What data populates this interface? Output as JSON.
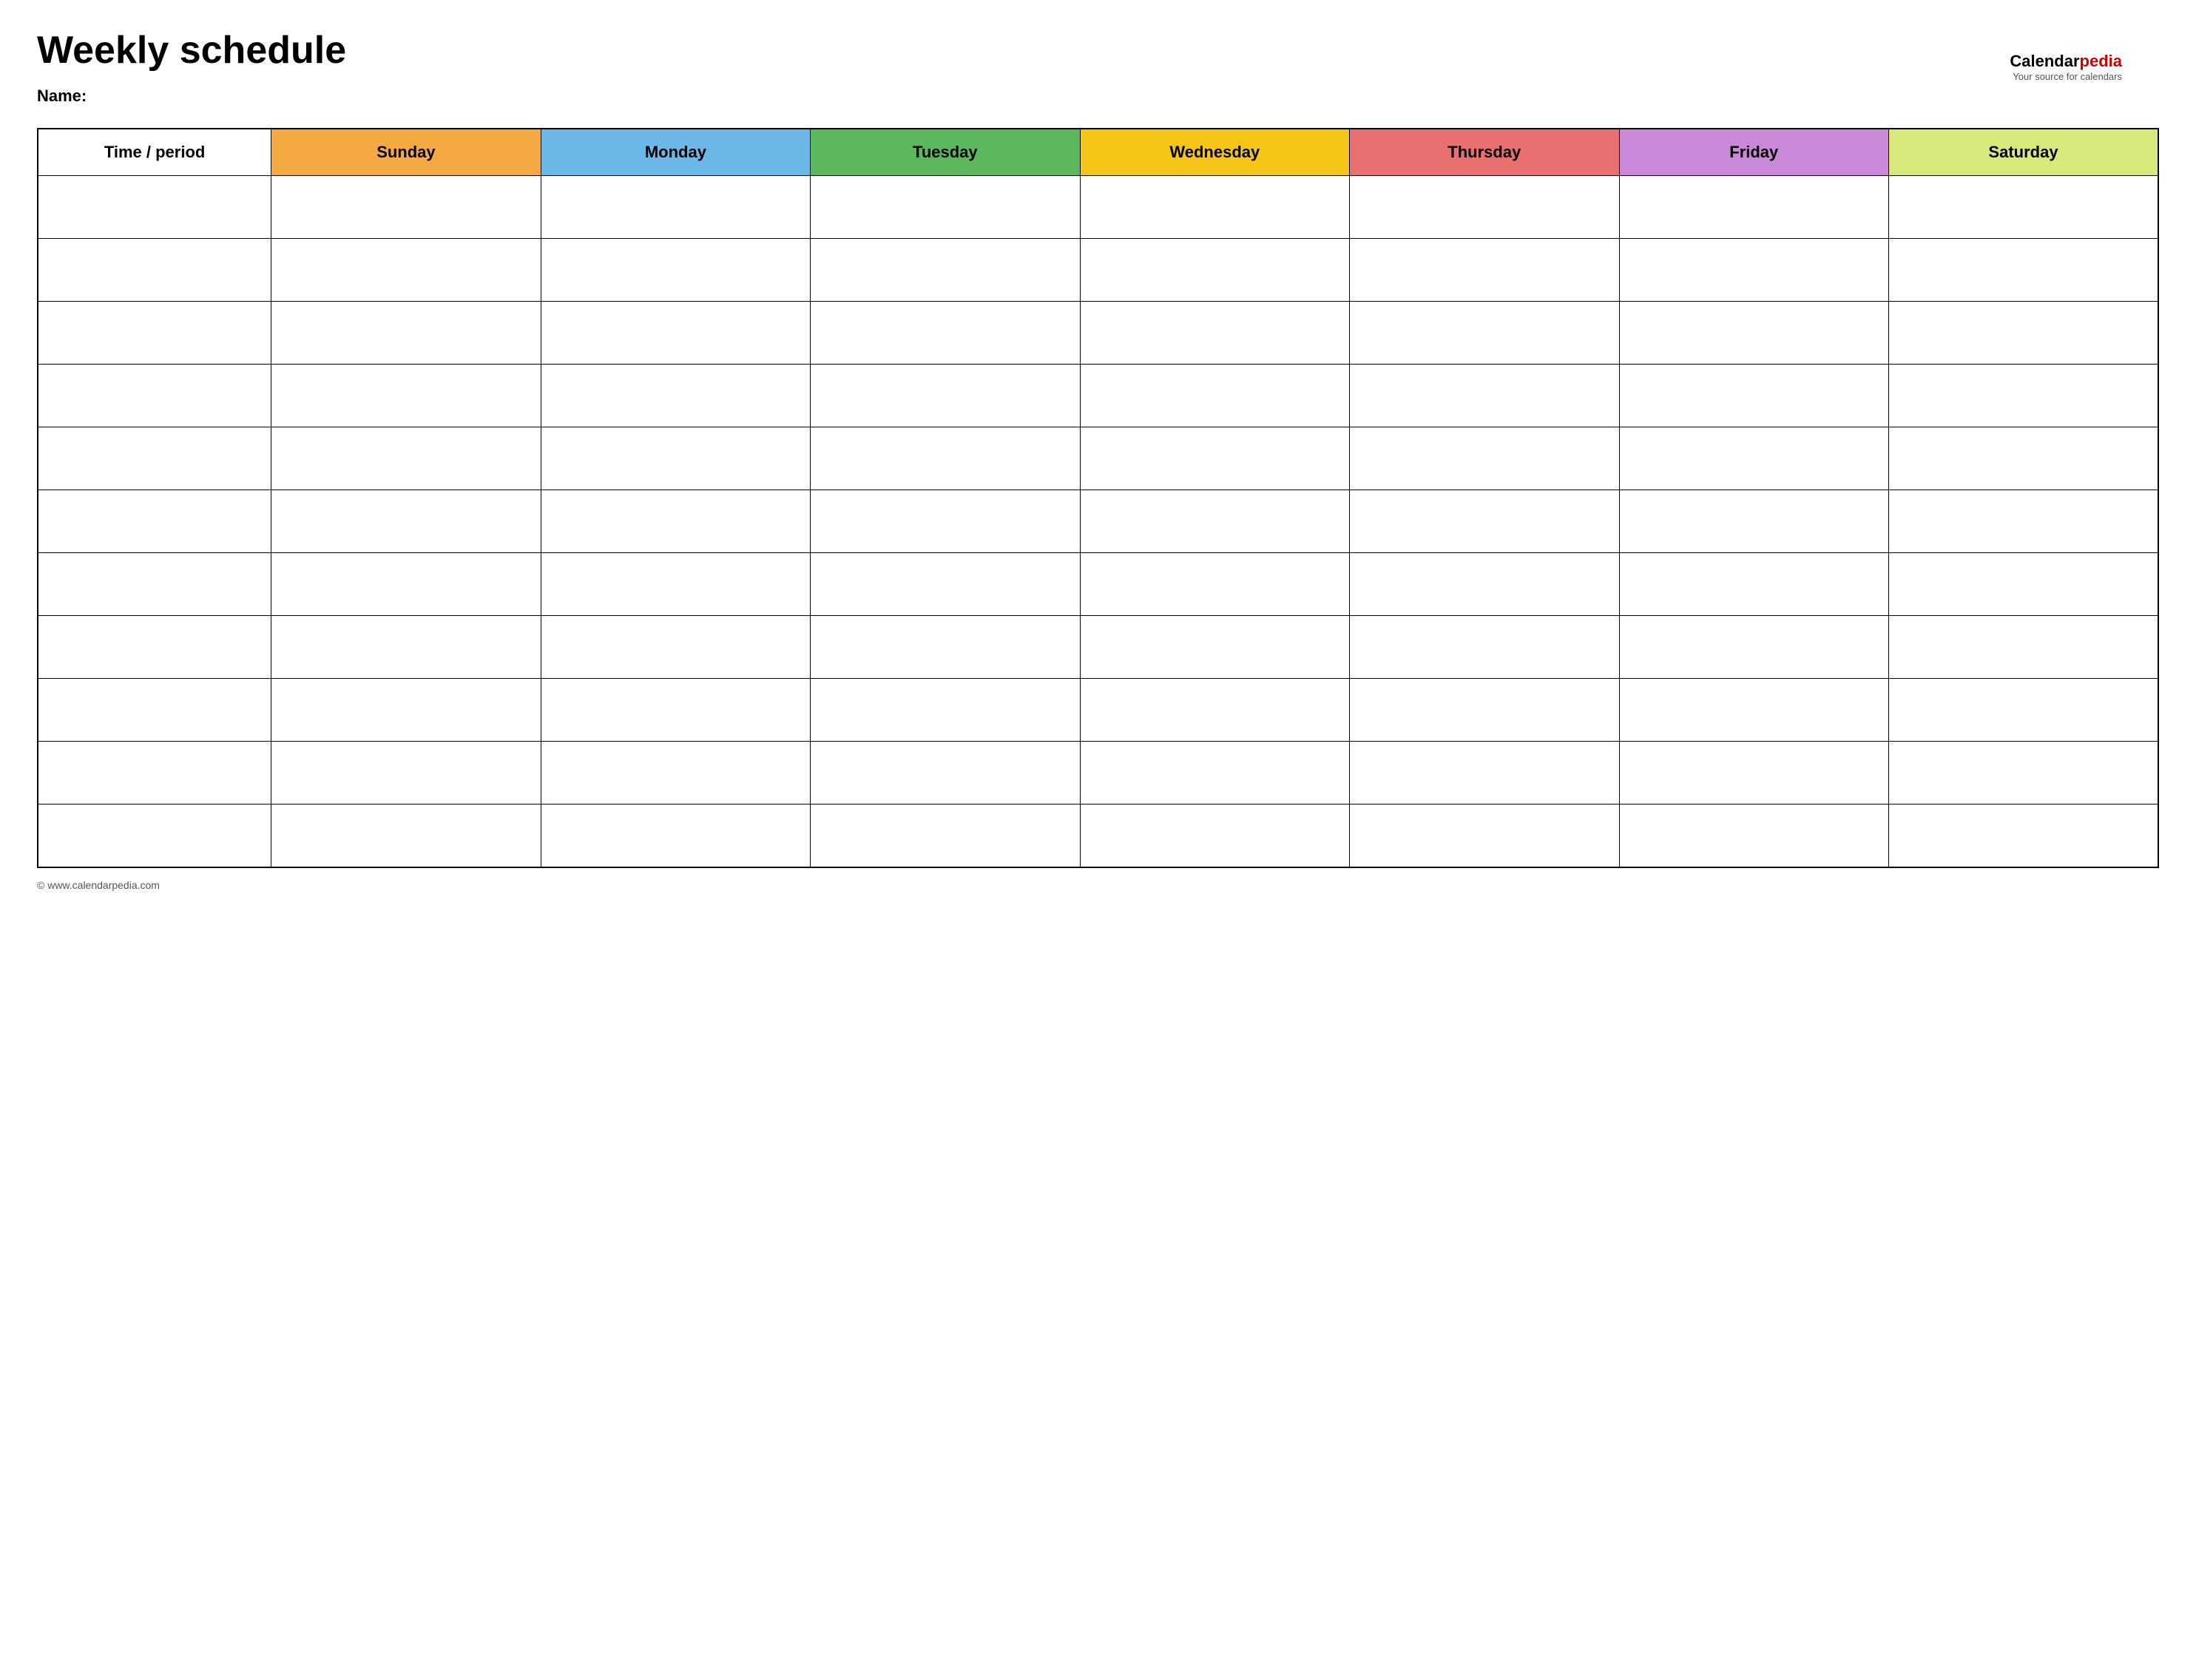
{
  "page": {
    "title": "Weekly schedule",
    "name_label": "Name:",
    "footer_text": "© www.calendarpedia.com"
  },
  "logo": {
    "brand_calendar": "Calendar",
    "brand_pedia": "pedia",
    "subtitle": "Your source for calendars"
  },
  "table": {
    "headers": [
      {
        "id": "time",
        "label": "Time / period",
        "color": "#ffffff"
      },
      {
        "id": "sunday",
        "label": "Sunday",
        "color": "#f4a942"
      },
      {
        "id": "monday",
        "label": "Monday",
        "color": "#6bb8e8"
      },
      {
        "id": "tuesday",
        "label": "Tuesday",
        "color": "#5cb85c"
      },
      {
        "id": "wednesday",
        "label": "Wednesday",
        "color": "#f5c518"
      },
      {
        "id": "thursday",
        "label": "Thursday",
        "color": "#e87070"
      },
      {
        "id": "friday",
        "label": "Friday",
        "color": "#c988d8"
      },
      {
        "id": "saturday",
        "label": "Saturday",
        "color": "#d8e87a"
      }
    ],
    "num_rows": 11
  }
}
